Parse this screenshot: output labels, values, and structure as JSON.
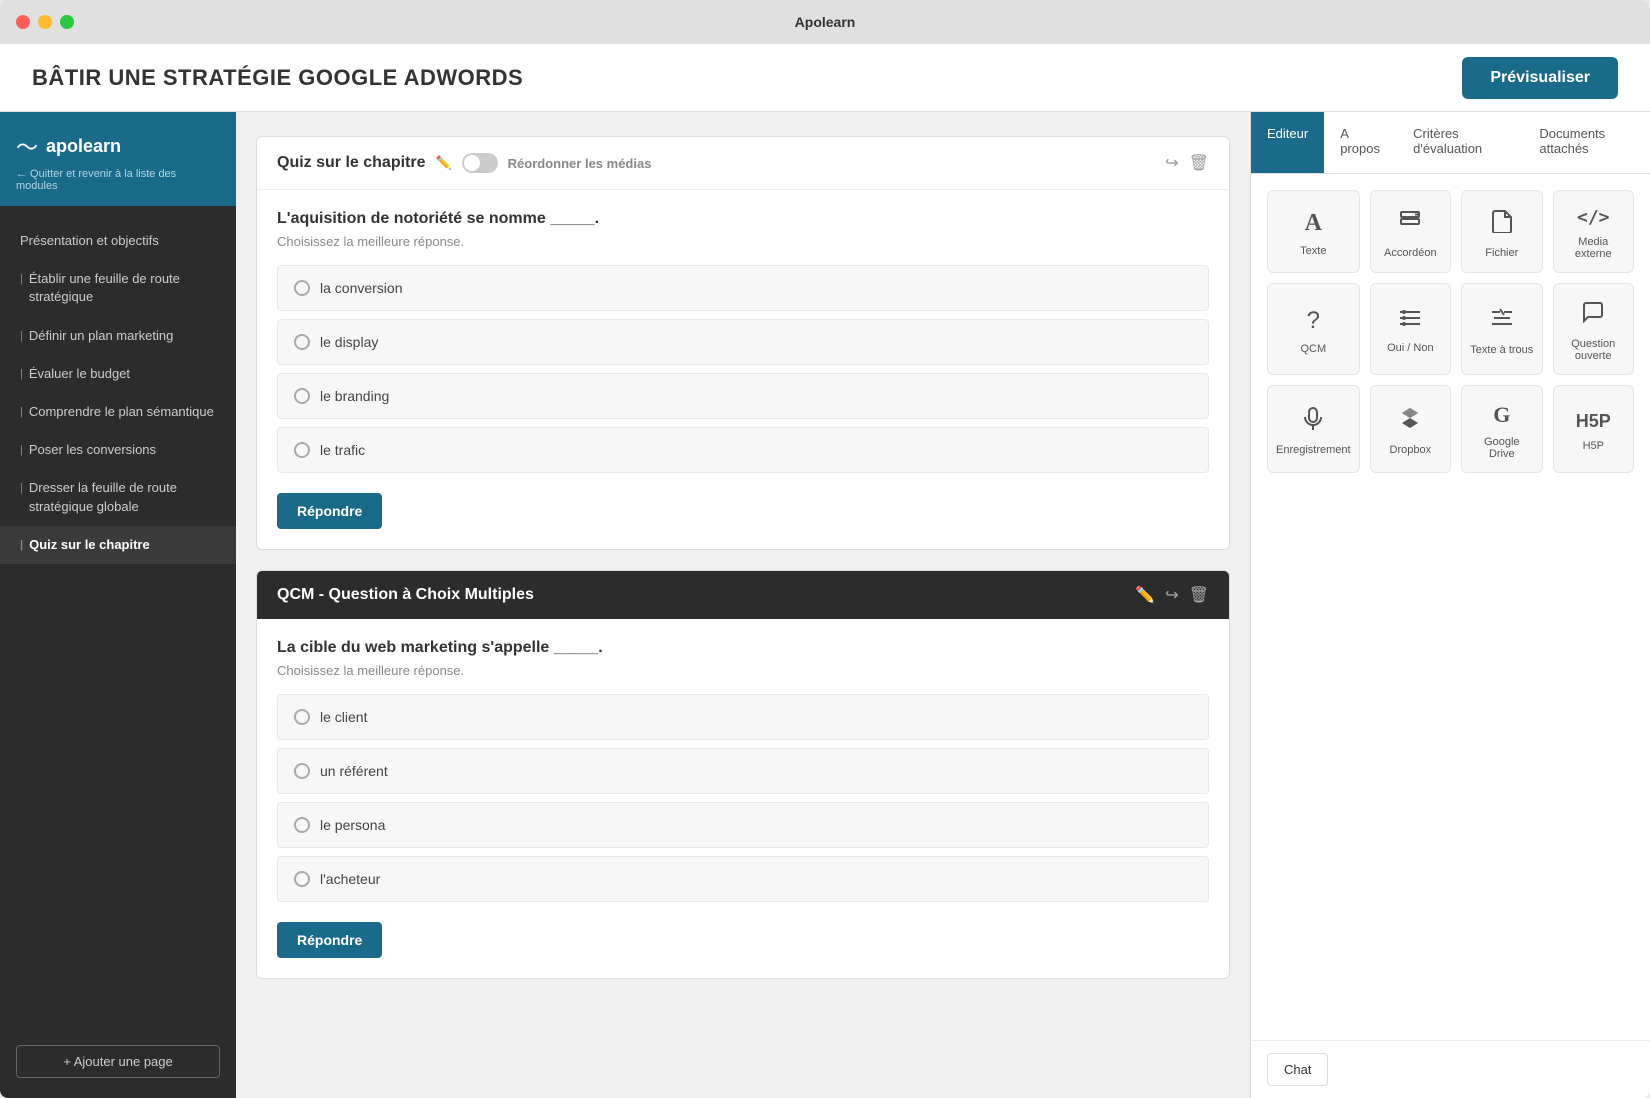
{
  "titleBar": {
    "title": "Apolearn",
    "controls": [
      "red",
      "yellow",
      "green"
    ]
  },
  "header": {
    "pageTitle": "BÂTIR UNE STRATÉGIE GOOGLE ADWORDS",
    "previewButton": "Prévisualiser"
  },
  "sidebar": {
    "logo": {
      "text": "apolearn",
      "backLink": "← Quitter et revenir à la liste des modules"
    },
    "items": [
      {
        "label": "Présentation et objectifs",
        "bullet": false,
        "active": false
      },
      {
        "label": "Établir une feuille de route stratégique",
        "bullet": true,
        "active": false
      },
      {
        "label": "Définir un plan marketing",
        "bullet": true,
        "active": false
      },
      {
        "label": "Évaluer le budget",
        "bullet": true,
        "active": false
      },
      {
        "label": "Comprendre le plan sémantique",
        "bullet": true,
        "active": false
      },
      {
        "label": "Poser les conversions",
        "bullet": true,
        "active": false
      },
      {
        "label": "Dresser la feuille de route stratégique globale",
        "bullet": true,
        "active": false
      },
      {
        "label": "Quiz sur le chapitre",
        "bullet": true,
        "active": true
      }
    ],
    "addPageButton": "+ Ajouter une page"
  },
  "quiz1": {
    "title": "Quiz sur le chapitre",
    "reorderLabel": "Réordonner les médias",
    "questionText": "L'aquisition de notoriété se nomme _____.",
    "questionSub": "Choisissez la meilleure réponse.",
    "options": [
      "la conversion",
      "le display",
      "le branding",
      "le trafic"
    ],
    "respondButton": "Répondre"
  },
  "quiz2": {
    "title": "QCM - Question à Choix Multiples",
    "questionText": "La cible du web marketing s'appelle _____.",
    "questionSub": "Choisissez la meilleure réponse.",
    "options": [
      "le client",
      "un référent",
      "le persona",
      "l'acheteur"
    ],
    "respondButton": "Répondre"
  },
  "rightPanel": {
    "tabs": [
      {
        "label": "Editeur",
        "active": true
      },
      {
        "label": "A propos",
        "active": false
      },
      {
        "label": "Critères d'évaluation",
        "active": false
      },
      {
        "label": "Documents attachés",
        "active": false
      }
    ],
    "blocks": [
      {
        "icon": "A",
        "label": "Texte",
        "type": "text"
      },
      {
        "icon": "⊞",
        "label": "Accordéon",
        "type": "accordion"
      },
      {
        "icon": "📄",
        "label": "Fichier",
        "type": "file"
      },
      {
        "icon": "</>",
        "label": "Media externe",
        "type": "external-media"
      },
      {
        "icon": "?",
        "label": "QCM",
        "type": "qcm"
      },
      {
        "icon": "≡",
        "label": "Oui / Non",
        "type": "oui-non"
      },
      {
        "icon": "✂",
        "label": "Texte à trous",
        "type": "texte-a-trous"
      },
      {
        "icon": "💬",
        "label": "Question ouverte",
        "type": "question-ouverte"
      },
      {
        "icon": "🎤",
        "label": "Enregistrement",
        "type": "enregistrement"
      },
      {
        "icon": "◈",
        "label": "Dropbox",
        "type": "dropbox"
      },
      {
        "icon": "G",
        "label": "Google Drive",
        "type": "google-drive"
      },
      {
        "icon": "H5P",
        "label": "H5P",
        "type": "h5p"
      }
    ]
  },
  "chat": {
    "label": "Chat"
  }
}
